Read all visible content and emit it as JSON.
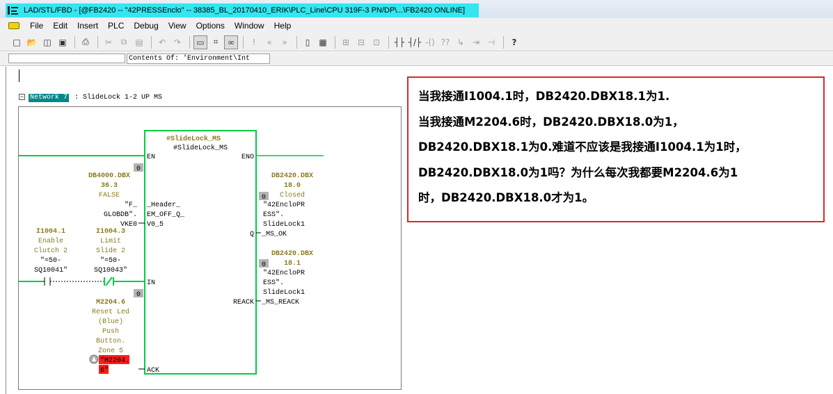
{
  "window": {
    "title": "LAD/STL/FBD  - [@FB2420 -- \"42PRESSEnclo\" -- 38385_BL_20170410_ERIK\\PLC_Line\\CPU 319F-3 PN/DP\\...\\FB2420  ONLINE]",
    "icon": "lad-editor-icon"
  },
  "menu": {
    "items": [
      "File",
      "Edit",
      "Insert",
      "PLC",
      "Debug",
      "View",
      "Options",
      "Window",
      "Help"
    ]
  },
  "toolbar": {
    "buttons": [
      {
        "icon": "new-icon",
        "glyph": "□"
      },
      {
        "icon": "open-icon",
        "glyph": "📂"
      },
      {
        "icon": "online-icon",
        "glyph": "◫"
      },
      {
        "icon": "save-icon",
        "glyph": "▣"
      },
      {
        "icon": "print-icon",
        "glyph": "⎙"
      },
      {
        "icon": "cut-icon",
        "glyph": "✂"
      },
      {
        "icon": "copy-icon",
        "glyph": "⧉"
      },
      {
        "icon": "paste-icon",
        "glyph": "▤"
      },
      {
        "icon": "undo-icon",
        "glyph": "↶"
      },
      {
        "icon": "redo-icon",
        "glyph": "↷"
      },
      {
        "icon": "monitor-icon",
        "glyph": "▭"
      },
      {
        "icon": "bookmark-icon",
        "glyph": "⌗"
      },
      {
        "icon": "glasses-icon",
        "glyph": "∞"
      },
      {
        "icon": "nav-first-icon",
        "glyph": "!"
      },
      {
        "icon": "nav-prev-icon",
        "glyph": "«"
      },
      {
        "icon": "nav-next-icon",
        "glyph": "»"
      },
      {
        "icon": "overview-icon",
        "glyph": "▯"
      },
      {
        "icon": "details-icon",
        "glyph": "▦"
      },
      {
        "icon": "new-network-icon",
        "glyph": "⊞"
      },
      {
        "icon": "branch-icon",
        "glyph": "⊟"
      },
      {
        "icon": "close-branch-icon",
        "glyph": "⊡"
      },
      {
        "icon": "no-contact-icon",
        "glyph": "┤├"
      },
      {
        "icon": "nc-contact-icon",
        "glyph": "┤/├"
      },
      {
        "icon": "coil-icon",
        "glyph": "-()"
      },
      {
        "icon": "box-icon",
        "glyph": "??"
      },
      {
        "icon": "open-branch-icon",
        "glyph": "↳"
      },
      {
        "icon": "close-branch2-icon",
        "glyph": "⇥"
      },
      {
        "icon": "connect-icon",
        "glyph": "⊣"
      },
      {
        "icon": "help-icon",
        "glyph": "?"
      }
    ]
  },
  "address_bar": {
    "contents": "Contents Of: 'Environment\\Int"
  },
  "network": {
    "toggle": "−",
    "label": "Network 7",
    "title": ": SlideLock 1-2 UP MS"
  },
  "fb_block": {
    "instance": "#SlideLock_MS",
    "name": "#SlideLock_MS",
    "pin_en": "EN",
    "pin_eno": "ENO",
    "pin_in": "IN",
    "pin_ack": "ACK",
    "pin_q": "Q",
    "pin_reack": "REACK"
  },
  "inputs": {
    "db4000_value": "0",
    "db4000_address": [
      "DB4000.DBX",
      "36.3"
    ],
    "db4000_state": "FALSE",
    "db4000_symbol": [
      "\"F_",
      "GLOBDB\".",
      "VKE0"
    ],
    "header_param": [
      "_Header_",
      "EM_OFF_Q_",
      "V0_5"
    ],
    "contact1": {
      "address": "I1004.1",
      "comment": [
        "Enable",
        "Clutch 2"
      ],
      "symbol": [
        "\"=50-",
        "SQ10041\""
      ]
    },
    "contact2": {
      "address": "I1004.3",
      "comment": [
        "Limit",
        "Slide 2"
      ],
      "symbol": [
        "\"=50-",
        "SQ10043\""
      ]
    },
    "in_value": "0",
    "reset": {
      "address": "M2204.6",
      "comment": [
        "Reset Led",
        "(Blue)",
        "Push",
        "Button.",
        "Zone 5"
      ],
      "symbol": [
        "\"M2204.",
        "6\""
      ]
    }
  },
  "outputs": {
    "q_value": "0",
    "q_address": [
      "DB2420.DBX",
      "18.0"
    ],
    "q_comment": "Closed",
    "q_symbol": [
      "\"42EncloPR",
      "ESS\".",
      "SlideLock1",
      "_MS_OK"
    ],
    "reack_value": "0",
    "reack_address": [
      "DB2420.DBX",
      "18.1"
    ],
    "reack_symbol": [
      "\"42EncloPR",
      "ESS\".",
      "SlideLock1",
      "_MS_REACK"
    ]
  },
  "annotation": {
    "lines": [
      "当我接通I1004.1时，DB2420.DBX18.1为1.",
      "当我接通M2204.6时，DB2420.DBX18.0为1，",
      "DB2420.DBX18.1为0.难道不应该是我接通I1004.1为1时，",
      "DB2420.DBX18.0为1吗？为什么每次我都要M2204.6为1",
      "时，DB2420.DBX18.0才为1。"
    ]
  },
  "colors": {
    "title_highlight": "#33e6ef",
    "network_label_bg": "#00888a",
    "power_flow": "#00cc44",
    "address_text": "#8a7a1f",
    "forced_red": "#ff1a1a",
    "annotation_border": "#d62a2a"
  }
}
